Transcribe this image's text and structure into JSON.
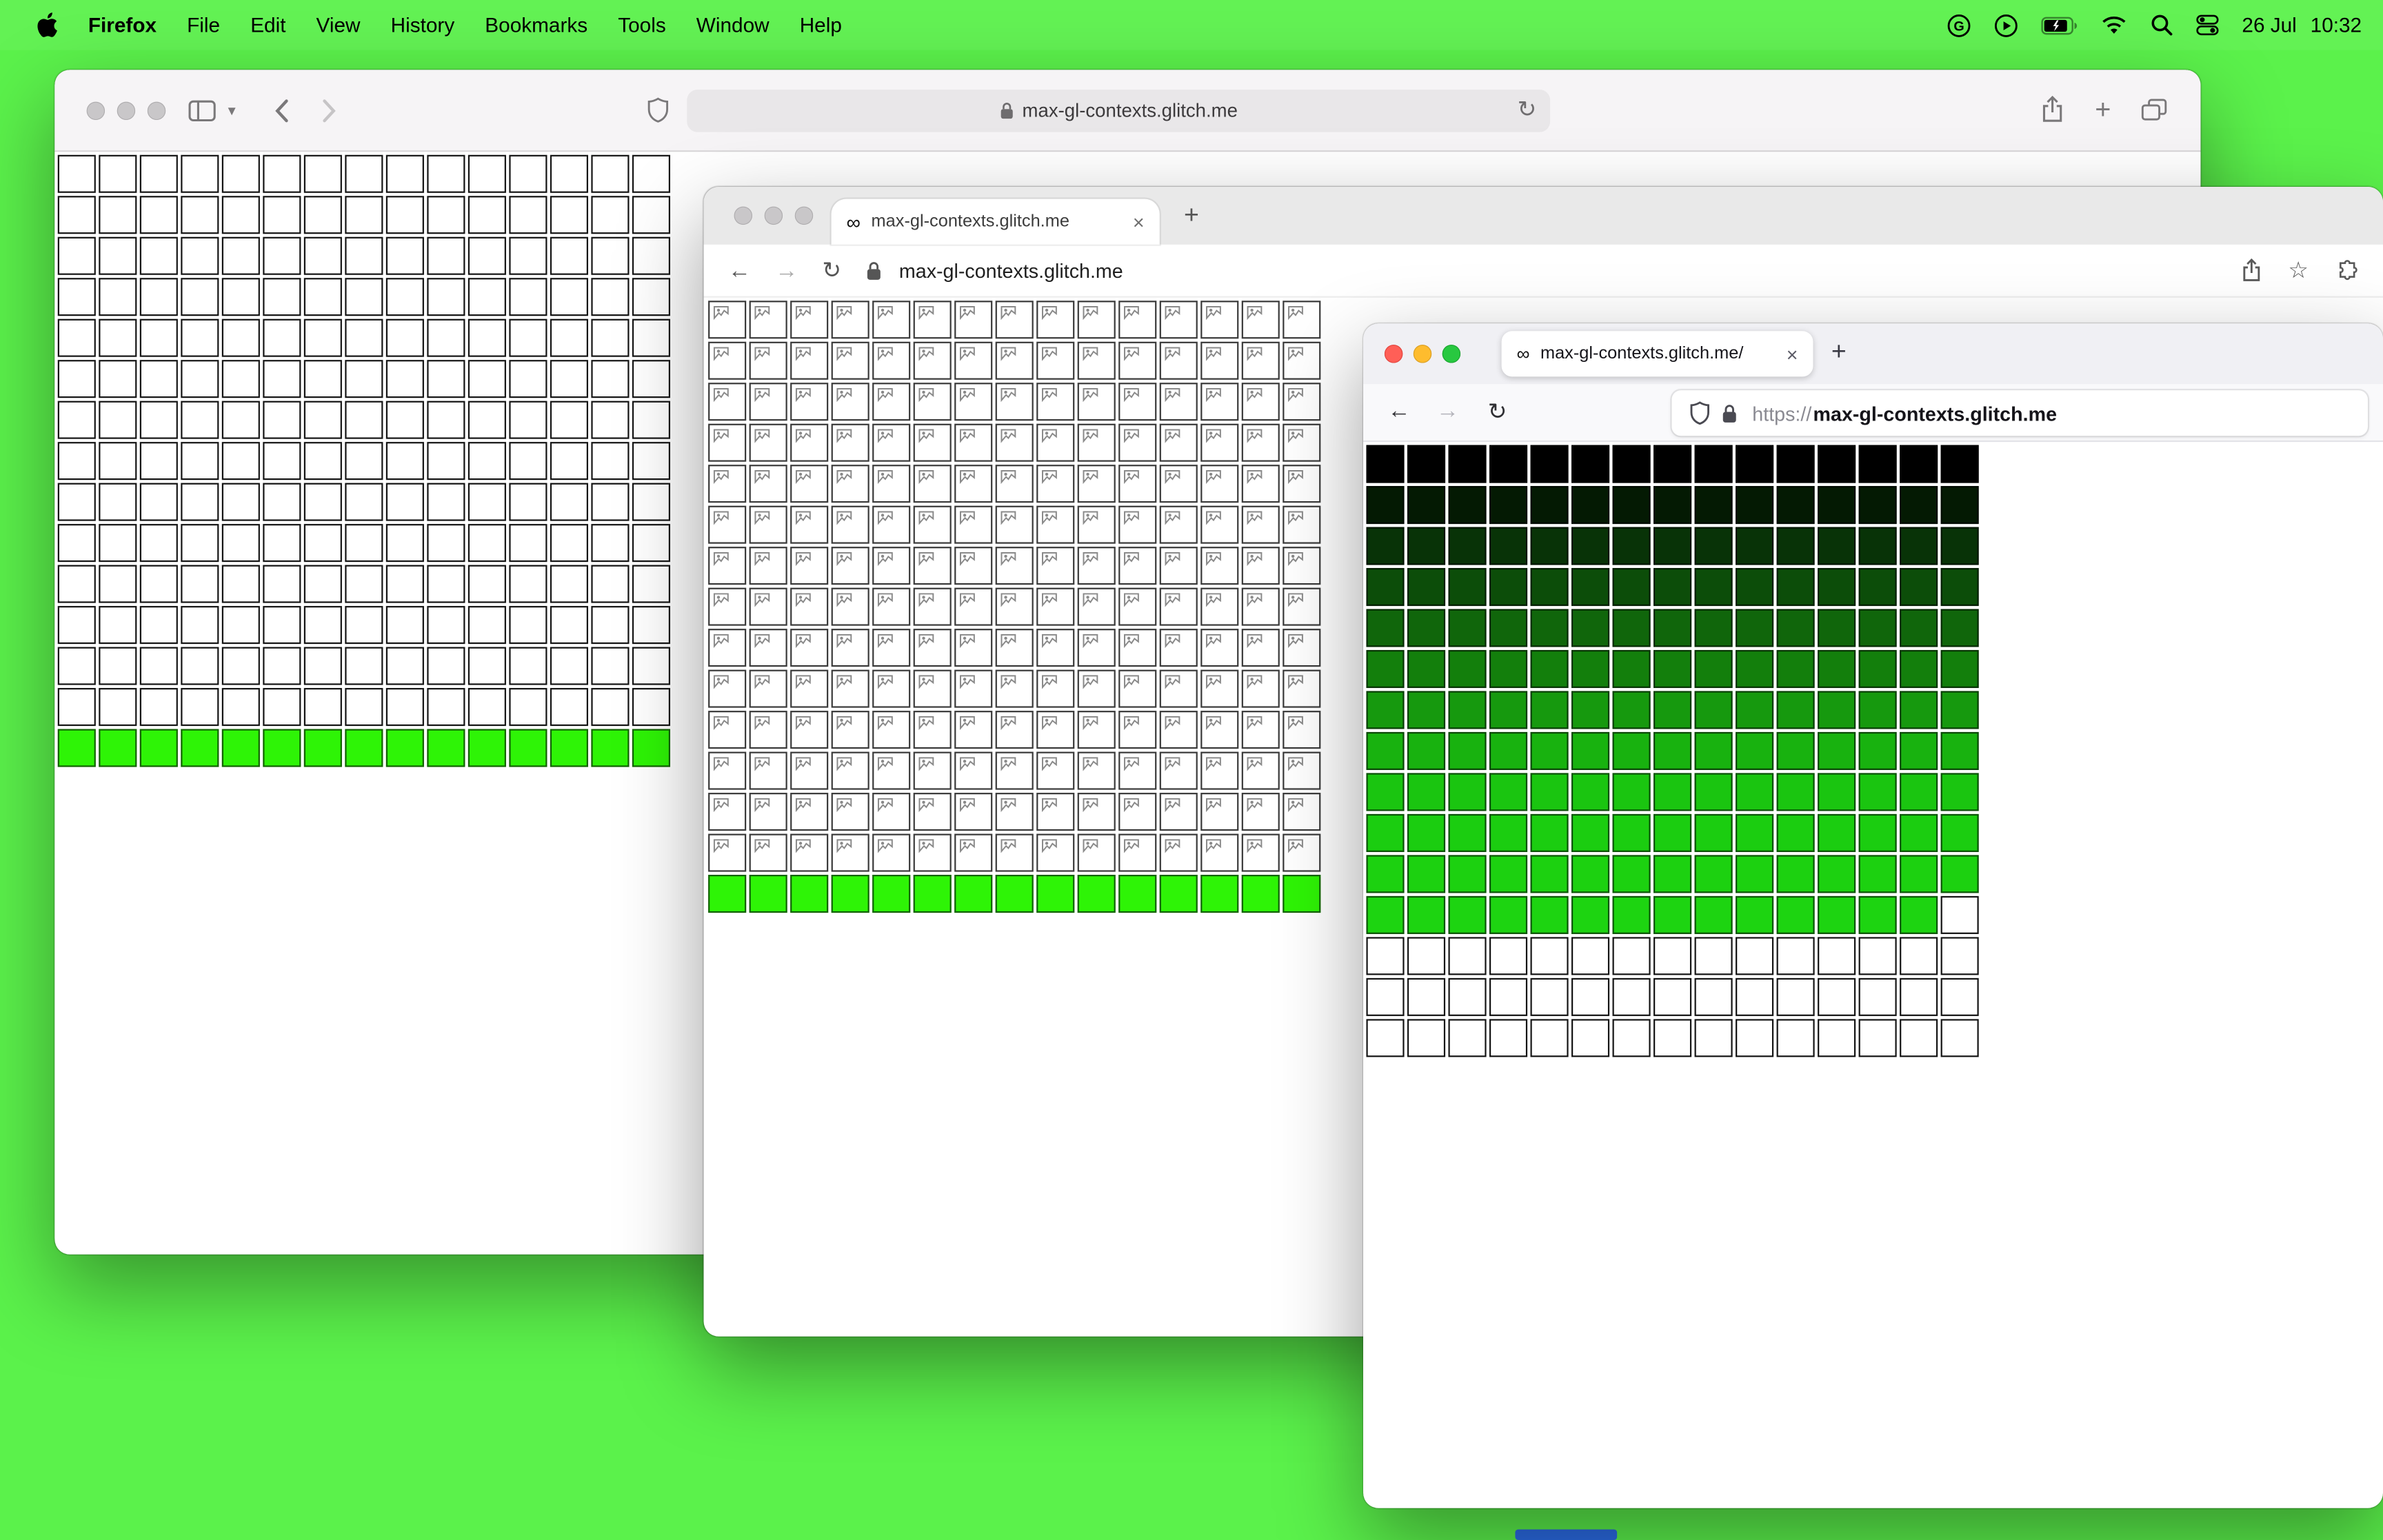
{
  "menubar": {
    "app_name": "Firefox",
    "items": [
      "File",
      "Edit",
      "View",
      "History",
      "Bookmarks",
      "Tools",
      "Window",
      "Help"
    ],
    "date": "26 Jul",
    "time": "10:32"
  },
  "glyphs": {
    "back": "←",
    "forward": "→",
    "reload": "↻",
    "infinity": "∞",
    "close": "×",
    "plus": "+",
    "star": "☆",
    "chevron_down": "▾"
  },
  "colors": {
    "desktop_green": "#5bf24b",
    "neon_green": "#2ef406",
    "firefox_gradient_top": "#000000",
    "firefox_gradient_bottom": "#1dd411",
    "blue_strip": "#2b6be4"
  },
  "safari_window": {
    "url": "max-gl-contexts.glitch.me"
  },
  "chrome_window": {
    "tab_title": "max-gl-contexts.glitch.me",
    "url": "max-gl-contexts.glitch.me"
  },
  "firefox_window": {
    "tab_title": "max-gl-contexts.glitch.me/",
    "url_scheme": "https://",
    "url_host": "max-gl-contexts.glitch.me"
  },
  "grids": {
    "safari": {
      "cols": 15,
      "cell": 25,
      "gap": 2,
      "rows": [
        {
          "fill": "white",
          "count": 14
        },
        {
          "fill": "#2ef406",
          "count": 1
        }
      ]
    },
    "chrome": {
      "cols": 15,
      "cell": 25,
      "gap": 2,
      "rows": [
        {
          "fill": "broken",
          "count": 14
        },
        {
          "fill": "#2ef406",
          "count": 1
        }
      ]
    },
    "firefox": {
      "cols": 15,
      "cell": 25,
      "gap": 2,
      "rows": [
        {
          "fill": "#000000"
        },
        {
          "fill": "#041a03"
        },
        {
          "fill": "#083307"
        },
        {
          "fill": "#0c4d09"
        },
        {
          "fill": "#10660b"
        },
        {
          "fill": "#137f0c"
        },
        {
          "fill": "#16990e"
        },
        {
          "fill": "#18b20f"
        },
        {
          "fill": "#1ac510"
        },
        {
          "fill": "#1bcd10"
        },
        {
          "fill": "#1cd110"
        },
        {
          "fill": "#1dd411",
          "last_cell": "white"
        },
        {
          "fill": "white",
          "count": 3
        }
      ]
    }
  }
}
